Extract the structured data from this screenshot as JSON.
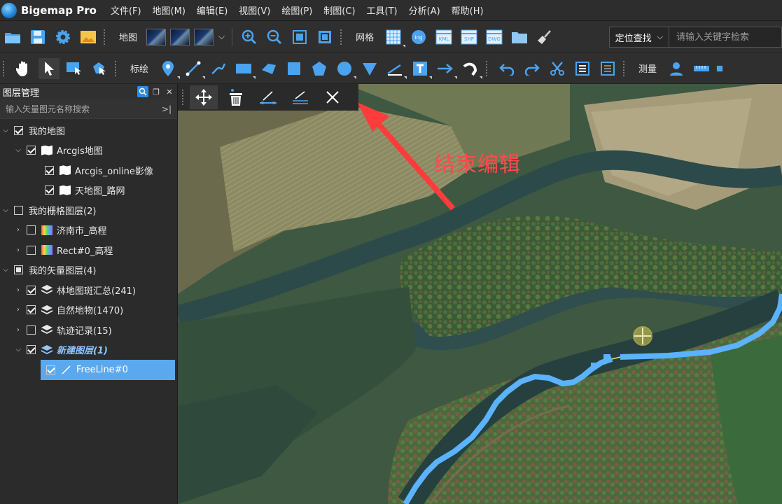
{
  "app": {
    "name": "Bigemap Pro"
  },
  "menu": [
    "文件(F)",
    "地图(M)",
    "编辑(E)",
    "视图(V)",
    "绘图(P)",
    "制图(C)",
    "工具(T)",
    "分析(A)",
    "帮助(H)"
  ],
  "toolbar1": {
    "map_label": "地图",
    "grid_label": "网格",
    "locate_label": "定位查找",
    "search_placeholder": "请输入关键字检索",
    "kml_label": "KML",
    "shp_label": "SHP",
    "dwg_label": "DWG"
  },
  "toolbar2": {
    "draw_label": "标绘",
    "measure_label": "测量"
  },
  "layer_panel": {
    "title": "图层管理",
    "search_placeholder": "输入矢量图元名称搜索",
    "items": [
      {
        "label": "我的地图",
        "checked": "checked"
      },
      {
        "label": "Arcgis地图",
        "checked": "checked"
      },
      {
        "label": "Arcgis_online影像",
        "checked": "checked"
      },
      {
        "label": "天地图_路网",
        "checked": "checked"
      },
      {
        "label": "我的栅格图层(2)",
        "checked": "unchecked"
      },
      {
        "label": "济南市_高程",
        "checked": "unchecked"
      },
      {
        "label": "Rect#0_高程",
        "checked": "unchecked"
      },
      {
        "label": "我的矢量图层(4)",
        "checked": "partial"
      },
      {
        "label": "林地图斑汇总(241)",
        "checked": "checked"
      },
      {
        "label": "自然地物(1470)",
        "checked": "checked"
      },
      {
        "label": "轨迹记录(15)",
        "checked": "unchecked"
      },
      {
        "label": "新建图层(1)",
        "checked": "checked"
      },
      {
        "label": "FreeLine#0",
        "checked": "checked"
      }
    ]
  },
  "annotation": {
    "text": "结束编辑",
    "color": "#ff4a4a"
  },
  "colors": {
    "accent": "#5aa9ee",
    "line": "#5bb2ff"
  }
}
